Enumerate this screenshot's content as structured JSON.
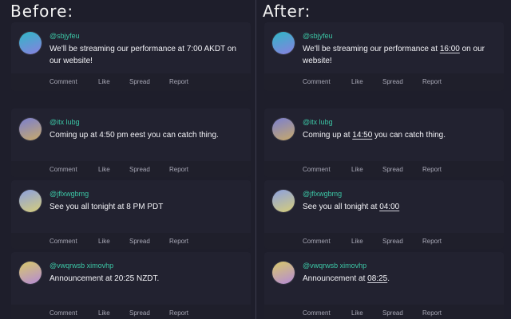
{
  "before": {
    "title": "Before:",
    "posts": [
      {
        "handle": "@sbjyfeu",
        "text_pre": "We'll be streaming our performance at ",
        "time": "7:00 AKDT",
        "text_post": " on our website!",
        "avatar_colors": [
          "#2fb8c6",
          "#8a7fe0"
        ]
      },
      {
        "handle": "@itx lubg",
        "text_pre": "Coming up at ",
        "time": "4:50 pm eest",
        "text_post": " you can catch thing.",
        "avatar_colors": [
          "#7a7fd0",
          "#c8a96a"
        ]
      },
      {
        "handle": "@jflxwgbmg",
        "text_pre": "See you all tonight at ",
        "time": "8 PM PDT",
        "text_post": "",
        "avatar_colors": [
          "#8ca0e0",
          "#d6cd7a"
        ]
      },
      {
        "handle": "@vwqrwsb ximovhp",
        "text_pre": "Announcement at ",
        "time": "20:25 NZDT",
        "text_post": ".",
        "avatar_colors": [
          "#d8c96a",
          "#b48ad6"
        ]
      }
    ]
  },
  "after": {
    "title": "After:",
    "posts": [
      {
        "handle": "@sbjyfeu",
        "text_pre": "We'll be streaming our performance at ",
        "time": "16:00",
        "text_post": " on our website!",
        "avatar_colors": [
          "#2fb8c6",
          "#8a7fe0"
        ]
      },
      {
        "handle": "@itx lubg",
        "text_pre": "Coming up at ",
        "time": "14:50",
        "text_post": " you can catch thing.",
        "avatar_colors": [
          "#7a7fd0",
          "#c8a96a"
        ]
      },
      {
        "handle": "@jflxwgbmg",
        "text_pre": "See you all tonight at ",
        "time": "04:00",
        "text_post": "",
        "avatar_colors": [
          "#8ca0e0",
          "#d6cd7a"
        ]
      },
      {
        "handle": "@vwqrwsb ximovhp",
        "text_pre": "Announcement at ",
        "time": "08:25",
        "text_post": ".",
        "avatar_colors": [
          "#d8c96a",
          "#b48ad6"
        ]
      }
    ]
  },
  "actions": {
    "comment": "Comment",
    "like": "Like",
    "spread": "Spread",
    "report": "Report"
  },
  "colors": {
    "background": "#1e1e2b",
    "card": "#222230",
    "handle": "#3cc7a6",
    "action_text": "#a7a7b5"
  }
}
